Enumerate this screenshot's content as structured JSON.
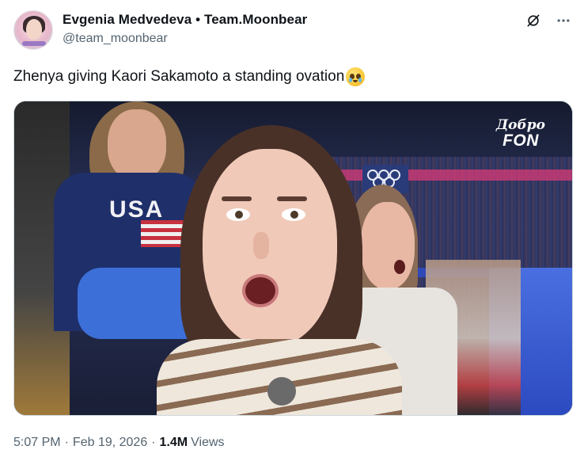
{
  "author": {
    "display_name": "Evgenia Medvedeva • Team.Moonbear",
    "handle": "@team_moonbear",
    "avatar_icon": "profile-avatar"
  },
  "actions": {
    "grok_icon": "grok-icon",
    "more_icon": "more-dots-icon"
  },
  "tweet": {
    "text": "Zhenya giving Kaori Sakamoto a standing ovation",
    "emoji": "face-holding-back-tears-emoji"
  },
  "media": {
    "watermark_top": "Добро",
    "watermark_bottom": "FON",
    "shirt_text": "USA"
  },
  "meta": {
    "time": "5:07 PM",
    "separator": "·",
    "date": "Feb 19, 2026",
    "views_count": "1.4M",
    "views_label": "Views"
  },
  "colors": {
    "text_primary": "#0f1419",
    "text_secondary": "#536471",
    "border": "#cfd9de"
  }
}
